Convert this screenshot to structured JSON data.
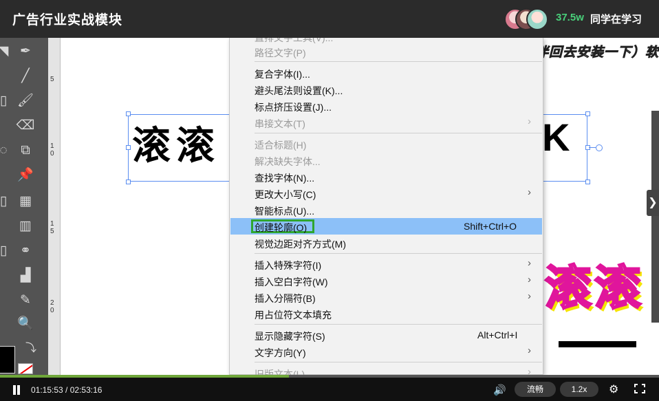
{
  "header": {
    "title": "广告行业实战模块",
    "viewer_count": "37.5w",
    "viewer_label": "同学在学习"
  },
  "canvas": {
    "subtitle": "载的小伙伴回去安装一下）软",
    "big_text": "滚滚",
    "big_text_right": "K",
    "effect_text": "滚滚",
    "ruler_ticks": [
      "5",
      "1 0",
      "1 5",
      "2 0"
    ]
  },
  "menu": {
    "items": [
      {
        "label": "直排文字工具(V)...",
        "shortcut": "",
        "submenu": false,
        "disabled": true
      },
      {
        "label": "路径文字(P)",
        "shortcut": "",
        "submenu": false,
        "disabled": true
      },
      {
        "label": "复合字体(I)...",
        "shortcut": "",
        "submenu": false,
        "disabled": false
      },
      {
        "label": "避头尾法则设置(K)...",
        "shortcut": "",
        "submenu": false,
        "disabled": false
      },
      {
        "label": "标点挤压设置(J)...",
        "shortcut": "",
        "submenu": false,
        "disabled": false
      },
      {
        "label": "串接文本(T)",
        "shortcut": "",
        "submenu": true,
        "disabled": true
      },
      {
        "label": "适合标题(H)",
        "shortcut": "",
        "submenu": false,
        "disabled": true
      },
      {
        "label": "解决缺失字体...",
        "shortcut": "",
        "submenu": false,
        "disabled": true
      },
      {
        "label": "查找字体(N)...",
        "shortcut": "",
        "submenu": false,
        "disabled": false
      },
      {
        "label": "更改大小写(C)",
        "shortcut": "",
        "submenu": true,
        "disabled": false
      },
      {
        "label": "智能标点(U)...",
        "shortcut": "",
        "submenu": false,
        "disabled": false
      },
      {
        "label": "创建轮廓(O)",
        "shortcut": "Shift+Ctrl+O",
        "submenu": false,
        "disabled": false,
        "highlighted": true
      },
      {
        "label": "视觉边距对齐方式(M)",
        "shortcut": "",
        "submenu": false,
        "disabled": false
      },
      {
        "label": "插入特殊字符(I)",
        "shortcut": "",
        "submenu": true,
        "disabled": false
      },
      {
        "label": "插入空白字符(W)",
        "shortcut": "",
        "submenu": true,
        "disabled": false
      },
      {
        "label": "插入分隔符(B)",
        "shortcut": "",
        "submenu": true,
        "disabled": false
      },
      {
        "label": "用占位符文本填充",
        "shortcut": "",
        "submenu": false,
        "disabled": false
      },
      {
        "label": "显示隐藏字符(S)",
        "shortcut": "Alt+Ctrl+I",
        "submenu": false,
        "disabled": false
      },
      {
        "label": "文字方向(Y)",
        "shortcut": "",
        "submenu": true,
        "disabled": false
      },
      {
        "label": "旧版文本(L)",
        "shortcut": "",
        "submenu": true,
        "disabled": true
      }
    ],
    "highlight_color": "#8cc0f8",
    "highlight_border_color": "#2fa62f"
  },
  "player": {
    "current_time": "01:15:53",
    "duration": "02:53:16",
    "progress_fraction": 0.438,
    "quality_label": "流畅",
    "speed_label": "1.2x"
  },
  "icons": [
    "pen-icon",
    "line-icon",
    "brush-icon",
    "eraser-icon",
    "scale-icon",
    "pin-icon",
    "grid-icon",
    "gradient-icon",
    "shape-builder-icon",
    "bar-graph-icon",
    "eyedropper-icon",
    "zoom-icon",
    "swap-icon",
    "volume-icon",
    "gear-icon",
    "fullscreen-icon",
    "chevron-right-icon"
  ],
  "colors": {
    "topbar": "#2b2b2b",
    "accent_green": "#49d07a",
    "progress": "#6fa63a",
    "toolbar": "#535353"
  }
}
